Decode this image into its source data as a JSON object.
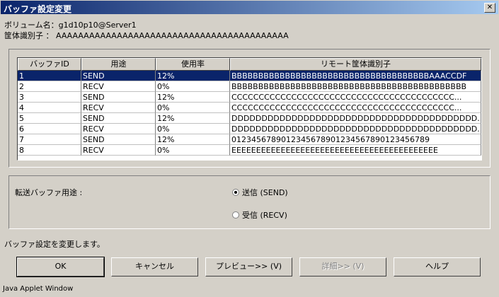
{
  "window": {
    "title": "バッファ設定変更",
    "close_glyph": "✕"
  },
  "info": {
    "volume": "ボリューム名：g1d10p10@Server1",
    "chassis": "筐体識別子 ： AAAAAAAAAAAAAAAAAAAAAAAAAAAAAAAAAAAAAAAAAA"
  },
  "table": {
    "headers": [
      "バッファID",
      "用途",
      "使用率",
      "リモート筐体識別子"
    ],
    "rows": [
      [
        "1",
        "SEND",
        "12%",
        "BBBBBBBBBBBBBBBBBBBBBBBBBBBBBBBBBBBBBAAACCDF"
      ],
      [
        "2",
        "RECV",
        "0%",
        "BBBBBBBBBBBBBBBBBBBBBBBBBBBBBBBBBBBBBBBBBBBB"
      ],
      [
        "3",
        "SEND",
        "12%",
        "CCCCCCCCCCCCCCCCCCCCCCCCCCCCCCCCCCCCCCCCC..."
      ],
      [
        "4",
        "RECV",
        "0%",
        "CCCCCCCCCCCCCCCCCCCCCCCCCCCCCCCCCCCCCCCCC..."
      ],
      [
        "5",
        "SEND",
        "12%",
        "DDDDDDDDDDDDDDDDDDDDDDDDDDDDDDDDDDDDDDDDD..."
      ],
      [
        "6",
        "RECV",
        "0%",
        "DDDDDDDDDDDDDDDDDDDDDDDDDDDDDDDDDDDDDDDDD..."
      ],
      [
        "7",
        "SEND",
        "12%",
        "0123456789012345678901234567890123456789"
      ],
      [
        "8",
        "RECV",
        "0%",
        "EEEEEEEEEEEEEEEEEEEEEEEEEEEEEEEEEEEEEEEEEE"
      ]
    ]
  },
  "transfer": {
    "label": "転送バッファ用途 :",
    "send": "送信 (SEND)",
    "recv": "受信 (RECV)"
  },
  "status": "バッファ設定を変更します。",
  "buttons": {
    "ok": "OK",
    "cancel": "キャンセル",
    "preview": "プレビュー>> (V)",
    "details": "詳細>> (V)",
    "help": "ヘルプ"
  },
  "footer": "Java Applet Window"
}
